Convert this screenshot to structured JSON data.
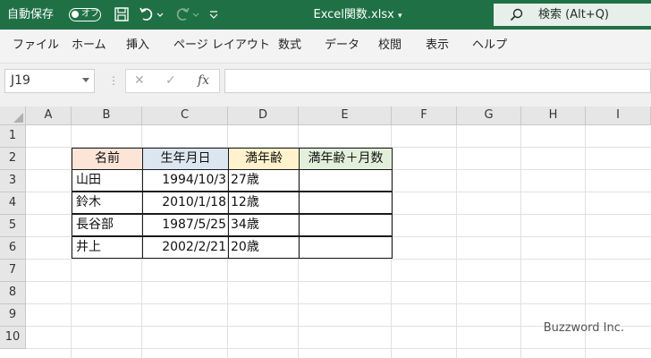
{
  "titlebar": {
    "autosave_label": "自動保存",
    "autosave_state": "オフ",
    "doc_title": "Excel関数.xlsx",
    "search_text": "検索 (Alt+Q)",
    "bg_color": "#1f7145"
  },
  "menu": [
    "ファイル",
    "ホーム",
    "挿入",
    "ページ レイアウト",
    "数式",
    "データ",
    "校閲",
    "表示",
    "ヘルプ"
  ],
  "formula_bar": {
    "name_box": "J19",
    "fx_label": "fx",
    "formula": ""
  },
  "columns": [
    "A",
    "B",
    "C",
    "D",
    "E",
    "F",
    "G",
    "H",
    "I"
  ],
  "rows": [
    "1",
    "2",
    "3",
    "4",
    "5",
    "6",
    "7",
    "8",
    "9",
    "10"
  ],
  "table": {
    "headers": [
      "名前",
      "生年月日",
      "満年齢",
      "満年齢＋月数"
    ],
    "header_colors": [
      "#fce4d6",
      "#dce6f1",
      "#fff2cc",
      "#e2efda"
    ],
    "rows": [
      [
        "山田",
        "1994/10/3",
        "27歳",
        ""
      ],
      [
        "鈴木",
        "2010/1/18",
        "12歳",
        ""
      ],
      [
        "長谷部",
        "1987/5/25",
        "34歳",
        ""
      ],
      [
        "井上",
        "2002/2/21",
        "20歳",
        ""
      ]
    ]
  },
  "watermark": "Buzzword Inc."
}
